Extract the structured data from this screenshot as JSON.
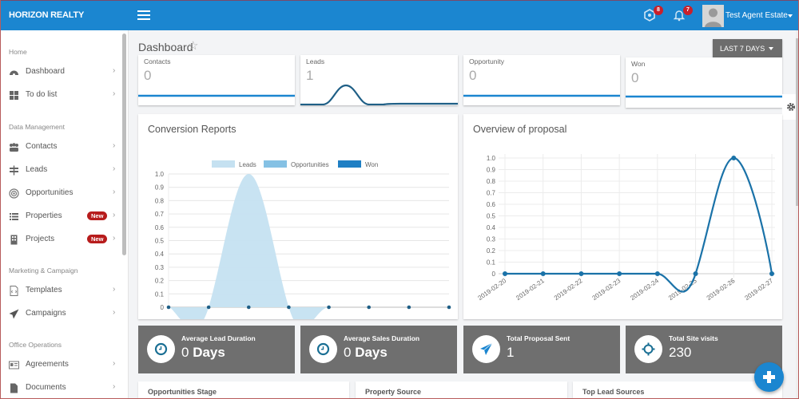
{
  "header": {
    "brand": "HORIZON REALTY",
    "notifications": [
      {
        "icon": "hexagon-alert-icon",
        "count": "8"
      },
      {
        "icon": "bell-icon",
        "count": "7"
      }
    ],
    "user_name": "Test Agent Estate"
  },
  "sidebar": {
    "sections": [
      {
        "title": "Home",
        "items": [
          {
            "label": "Dashboard",
            "icon": "dashboard-icon"
          },
          {
            "label": "To do list",
            "icon": "grid-icon"
          }
        ]
      },
      {
        "title": "Data Management",
        "items": [
          {
            "label": "Contacts",
            "icon": "users-icon"
          },
          {
            "label": "Leads",
            "icon": "signpost-icon"
          },
          {
            "label": "Opportunities",
            "icon": "target-icon"
          },
          {
            "label": "Properties",
            "icon": "list-icon",
            "badge": "New"
          },
          {
            "label": "Projects",
            "icon": "building-icon",
            "badge": "New"
          }
        ]
      },
      {
        "title": "Marketing & Campaign",
        "items": [
          {
            "label": "Templates",
            "icon": "template-icon"
          },
          {
            "label": "Campaigns",
            "icon": "paper-plane-icon"
          }
        ]
      },
      {
        "title": "Office Operations",
        "items": [
          {
            "label": "Agreements",
            "icon": "id-card-icon"
          },
          {
            "label": "Documents",
            "icon": "document-icon"
          }
        ]
      }
    ]
  },
  "main": {
    "title": "Dashboard",
    "range_button": "LAST 7 DAYS",
    "stats": [
      {
        "label": "Contacts",
        "value": "0"
      },
      {
        "label": "Leads",
        "value": "1"
      },
      {
        "label": "Opportunity",
        "value": "0"
      },
      {
        "label": "Won",
        "value": "0"
      }
    ],
    "kpis": [
      {
        "label": "Average Lead Duration",
        "value": "0",
        "unit": "Days",
        "icon": "clock-icon"
      },
      {
        "label": "Average Sales Duration",
        "value": "0",
        "unit": "Days",
        "icon": "clock-icon"
      },
      {
        "label": "Total Proposal Sent",
        "value": "1",
        "unit": "",
        "icon": "paper-plane-icon"
      },
      {
        "label": "Total Site visits",
        "value": "230",
        "unit": "",
        "icon": "crosshair-icon"
      }
    ],
    "bottom_panels": [
      "Opportunities Stage",
      "Property Source",
      "Top Lead Sources"
    ]
  },
  "chart_data": [
    {
      "type": "area",
      "title": "Conversion Reports",
      "legend": [
        "Leads",
        "Opportunities",
        "Won"
      ],
      "legend_position": "top",
      "colors": {
        "Leads": "#c5e1f1",
        "Opportunities": "#85c1e4",
        "Won": "#1f7fc4"
      },
      "x": [
        1,
        2,
        3,
        4,
        5,
        6,
        7,
        8
      ],
      "series": [
        {
          "name": "Leads",
          "values": [
            0,
            0,
            1,
            0,
            0,
            0,
            0,
            0
          ]
        },
        {
          "name": "Opportunities",
          "values": [
            0,
            0,
            0,
            0,
            0,
            0,
            0,
            0
          ]
        },
        {
          "name": "Won",
          "values": [
            0,
            0,
            0,
            0,
            0,
            0,
            0,
            0
          ]
        }
      ],
      "yticks": [
        "0",
        "0.1",
        "0.2",
        "0.3",
        "0.4",
        "0.5",
        "0.6",
        "0.7",
        "0.8",
        "0.9",
        "1.0"
      ],
      "ylim": [
        0,
        1
      ],
      "grid": true
    },
    {
      "type": "line",
      "title": "Overview of proposal",
      "categories": [
        "2019-02-20",
        "2019-02-21",
        "2019-02-22",
        "2019-02-23",
        "2019-02-24",
        "2019-02-25",
        "2019-02-26",
        "2019-02-27"
      ],
      "values": [
        0,
        0,
        0,
        0,
        0,
        0,
        1,
        0
      ],
      "color": "#1a72a8",
      "yticks": [
        "0",
        "0.1",
        "0.2",
        "0.3",
        "0.4",
        "0.5",
        "0.6",
        "0.7",
        "0.8",
        "0.9",
        "1.0"
      ],
      "ylim": [
        0,
        1
      ],
      "grid": true
    }
  ]
}
